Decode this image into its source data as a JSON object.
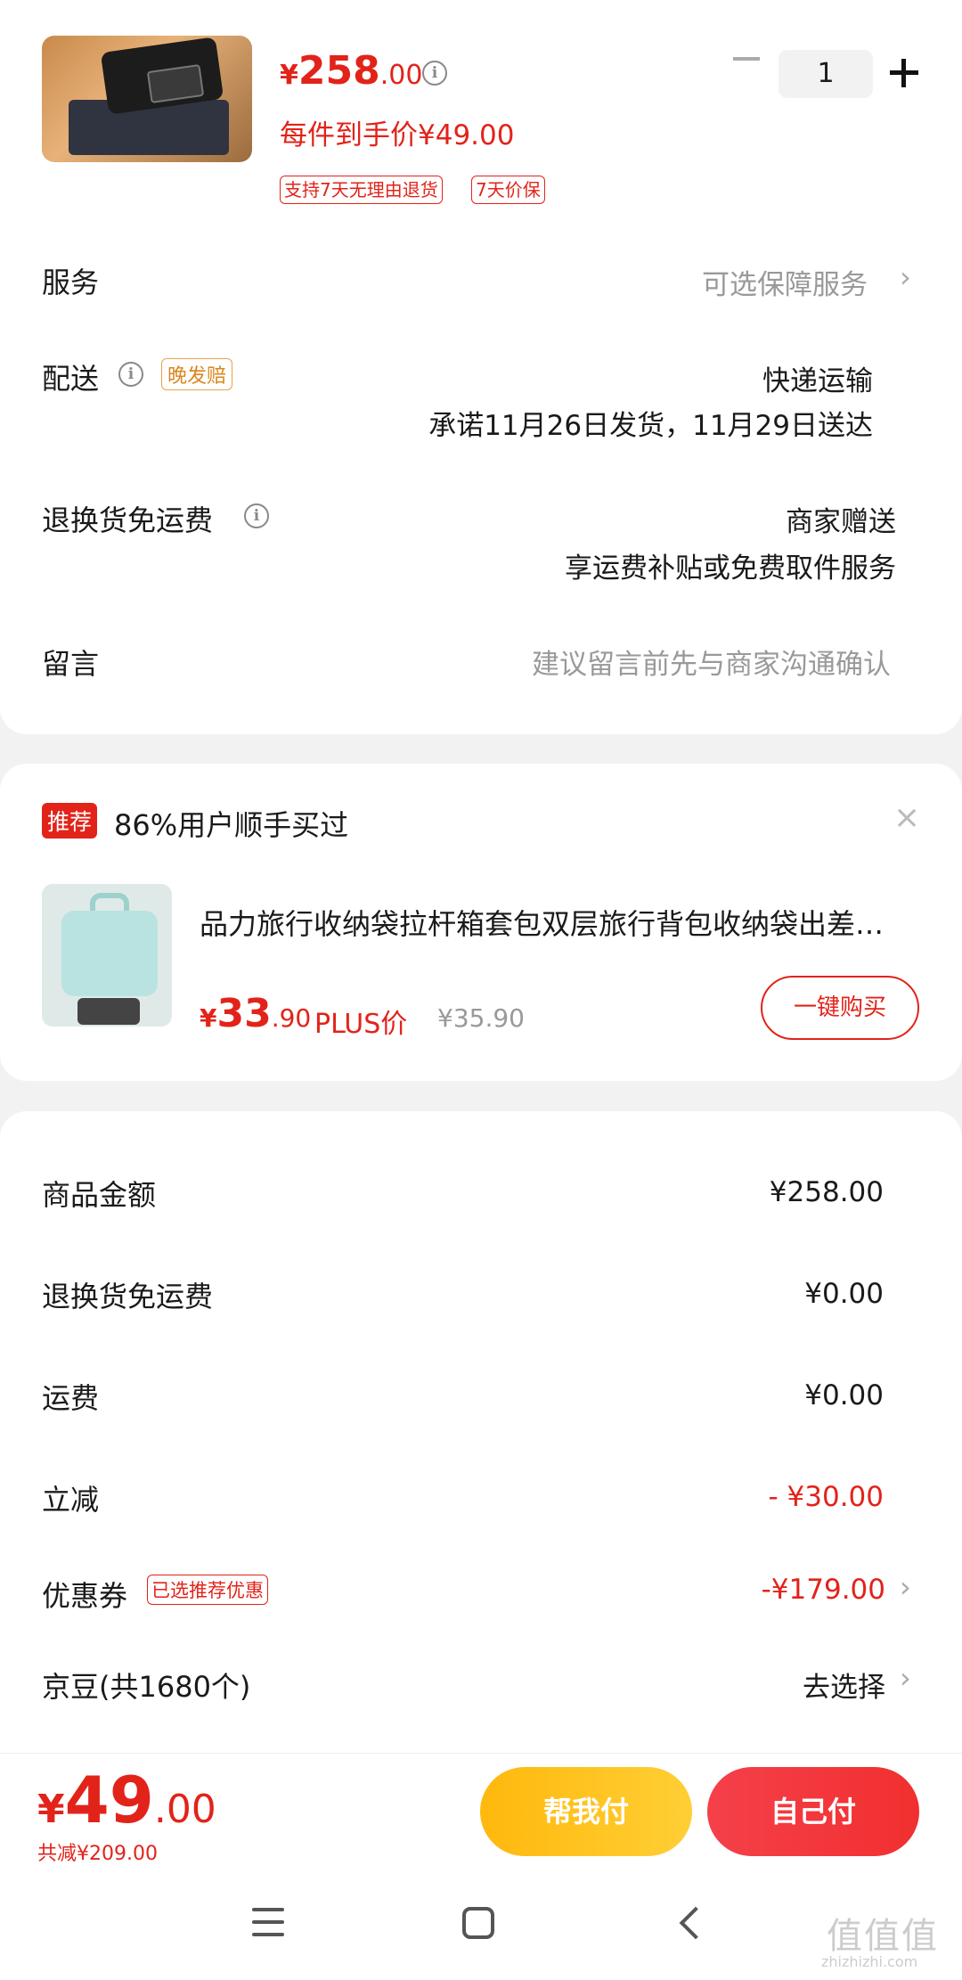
{
  "product": {
    "price_symbol": "¥",
    "price_int": "258",
    "price_dec": ".00",
    "unit_price": "每件到手价¥49.00",
    "tags": [
      "支持7天无理由退货",
      "7天价保"
    ],
    "quantity": "1"
  },
  "rows": {
    "service_label": "服务",
    "service_value": "可选保障服务",
    "delivery_label": "配送",
    "delivery_tag": "晚发赔",
    "delivery_method": "快递运输",
    "delivery_promise": "承诺11月26日发货，11月29日送达",
    "return_label": "退换货免运费",
    "return_value1": "商家赠送",
    "return_value2": "享运费补贴或免费取件服务",
    "message_label": "留言",
    "message_placeholder": "建议留言前先与商家沟通确认"
  },
  "recommend": {
    "badge": "推荐",
    "title": "86%用户顺手买过",
    "close": "×",
    "item_name": "品力旅行收纳袋拉杆箱套包双层旅行背包收纳袋出差便携",
    "price_symbol": "¥",
    "price_int": "33",
    "price_dec": ".90",
    "plus_label": "PLUS价",
    "original_price": "¥35.90",
    "buy_button": "一键购买"
  },
  "summary": {
    "goods_label": "商品金额",
    "goods_value": "¥258.00",
    "return_label": "退换货免运费",
    "return_value": "¥0.00",
    "shipping_label": "运费",
    "shipping_value": "¥0.00",
    "discount_label": "立减",
    "discount_value": "- ¥30.00",
    "coupon_label": "优惠券",
    "coupon_tag": "已选推荐优惠",
    "coupon_value": "-¥179.00",
    "beans_label": "京豆(共1680个)",
    "beans_value": "去选择"
  },
  "bottom": {
    "total_symbol": "¥",
    "total_int": "49",
    "total_dec": ".00",
    "total_saved": "共减¥209.00",
    "help_pay": "帮我付",
    "self_pay": "自己付"
  },
  "watermark": {
    "text": "值值值",
    "sub": "zhizhizhi.com"
  },
  "colors": {
    "accent_red": "#e2231a",
    "help_button": "#ffc020",
    "self_button": "#f23a3a",
    "tag_orange": "#d9861e"
  }
}
